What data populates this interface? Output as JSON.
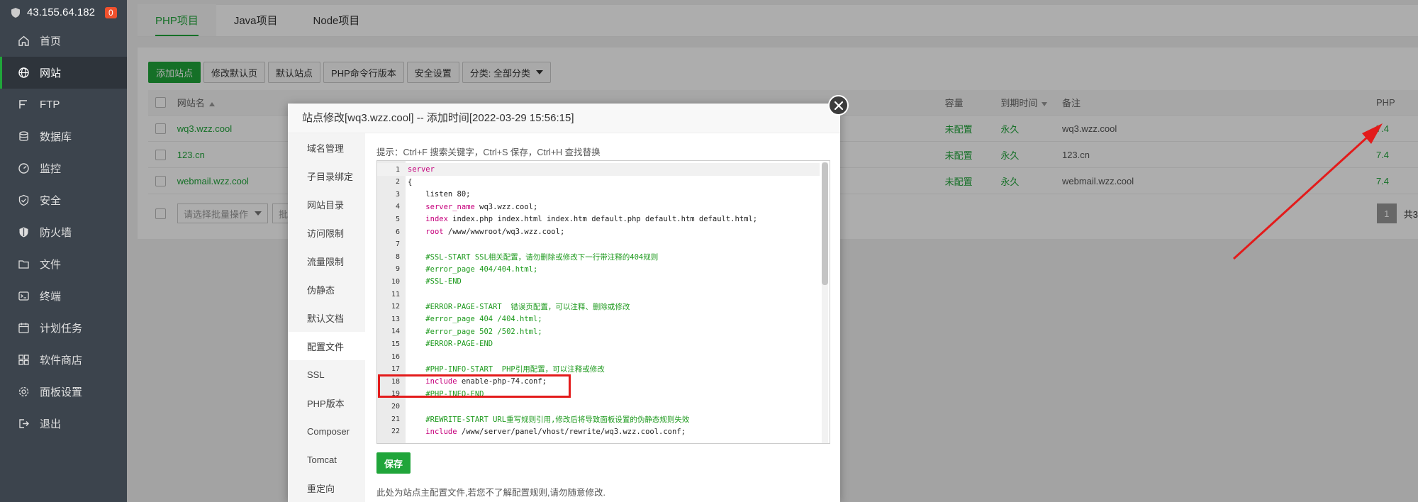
{
  "sidebar": {
    "server_ip": "43.155.64.182",
    "badge": "0",
    "items": [
      {
        "label": "首页",
        "icon": "home-icon"
      },
      {
        "label": "网站",
        "icon": "globe-icon",
        "active": true
      },
      {
        "label": "FTP",
        "icon": "ftp-icon"
      },
      {
        "label": "数据库",
        "icon": "database-icon"
      },
      {
        "label": "监控",
        "icon": "monitor-icon"
      },
      {
        "label": "安全",
        "icon": "shield-check-icon"
      },
      {
        "label": "防火墙",
        "icon": "firewall-icon"
      },
      {
        "label": "文件",
        "icon": "folder-icon"
      },
      {
        "label": "终端",
        "icon": "terminal-icon"
      },
      {
        "label": "计划任务",
        "icon": "calendar-icon"
      },
      {
        "label": "软件商店",
        "icon": "apps-icon"
      },
      {
        "label": "面板设置",
        "icon": "gear-icon"
      },
      {
        "label": "退出",
        "icon": "logout-icon"
      }
    ]
  },
  "tabs": [
    {
      "label": "PHP项目",
      "active": true
    },
    {
      "label": "Java项目"
    },
    {
      "label": "Node项目"
    }
  ],
  "toolbar": {
    "add_site": "添加站点",
    "edit_default_page": "修改默认页",
    "default_site": "默认站点",
    "php_cli_version": "PHP命令行版本",
    "security_settings": "安全设置",
    "category_filter": "分类: 全部分类"
  },
  "table": {
    "headers": {
      "name": "网站名",
      "capacity": "容量",
      "expire": "到期时间",
      "note": "备注",
      "php": "PHP"
    },
    "rows": [
      {
        "name": "wq3.wzz.cool",
        "capacity": "未配置",
        "expire": "永久",
        "note": "wq3.wzz.cool",
        "php": "7.4"
      },
      {
        "name": "123.cn",
        "capacity": "未配置",
        "expire": "永久",
        "note": "123.cn",
        "php": "7.4"
      },
      {
        "name": "webmail.wzz.cool",
        "capacity": "未配置",
        "expire": "永久",
        "note": "webmail.wzz.cool",
        "php": "7.4"
      }
    ],
    "batch_placeholder": "请选择批量操作",
    "batch_placeholder_2": "批",
    "page": "1",
    "total_prefix": "共3"
  },
  "modal": {
    "title": "站点修改[wq3.wzz.cool] -- 添加时间[2022-03-29 15:56:15]",
    "nav": [
      "域名管理",
      "子目录绑定",
      "网站目录",
      "访问限制",
      "流量限制",
      "伪静态",
      "默认文档",
      "配置文件",
      "SSL",
      "PHP版本",
      "Composer",
      "Tomcat",
      "重定向"
    ],
    "active_nav": "配置文件",
    "hint": "提示：Ctrl+F 搜索关键字，Ctrl+S 保存，Ctrl+H 查找替换",
    "save_label": "保存",
    "note": "此处为站点主配置文件,若您不了解配置规则,请勿随意修改."
  },
  "code_lines": [
    {
      "n": "1",
      "parts": [
        [
          "kw",
          "server"
        ]
      ]
    },
    {
      "n": "2",
      "parts": [
        [
          "",
          "{"
        ]
      ]
    },
    {
      "n": "3",
      "parts": [
        [
          "",
          "    listen 80;"
        ]
      ]
    },
    {
      "n": "4",
      "parts": [
        [
          "",
          "    "
        ],
        [
          "kw",
          "server_name"
        ],
        [
          "",
          " wq3.wzz.cool;"
        ]
      ]
    },
    {
      "n": "5",
      "parts": [
        [
          "",
          "    "
        ],
        [
          "kw",
          "index"
        ],
        [
          "",
          " index.php index.html index.htm default.php default.htm default.html;"
        ]
      ]
    },
    {
      "n": "6",
      "parts": [
        [
          "",
          "    "
        ],
        [
          "kw",
          "root"
        ],
        [
          "",
          " /www/wwwroot/wq3.wzz.cool;"
        ]
      ]
    },
    {
      "n": "7",
      "parts": [
        [
          "",
          ""
        ]
      ]
    },
    {
      "n": "8",
      "parts": [
        [
          "cm",
          "    #SSL-START SSL相关配置，请勿删除或修改下一行带注释的404规则"
        ]
      ]
    },
    {
      "n": "9",
      "parts": [
        [
          "cm",
          "    #error_page 404/404.html;"
        ]
      ]
    },
    {
      "n": "10",
      "parts": [
        [
          "cm",
          "    #SSL-END"
        ]
      ]
    },
    {
      "n": "11",
      "parts": [
        [
          "",
          ""
        ]
      ]
    },
    {
      "n": "12",
      "parts": [
        [
          "cm",
          "    #ERROR-PAGE-START  错误页配置，可以注释、删除或修改"
        ]
      ]
    },
    {
      "n": "13",
      "parts": [
        [
          "cm",
          "    #error_page 404 /404.html;"
        ]
      ]
    },
    {
      "n": "14",
      "parts": [
        [
          "cm",
          "    #error_page 502 /502.html;"
        ]
      ]
    },
    {
      "n": "15",
      "parts": [
        [
          "cm",
          "    #ERROR-PAGE-END"
        ]
      ]
    },
    {
      "n": "16",
      "parts": [
        [
          "",
          ""
        ]
      ]
    },
    {
      "n": "17",
      "parts": [
        [
          "cm",
          "    #PHP-INFO-START  PHP引用配置，可以注释或修改"
        ]
      ]
    },
    {
      "n": "18",
      "parts": [
        [
          "",
          "    "
        ],
        [
          "kw",
          "include"
        ],
        [
          "",
          " enable-php-74.conf;"
        ]
      ]
    },
    {
      "n": "19",
      "parts": [
        [
          "cm",
          "    #PHP-INFO-END"
        ]
      ]
    },
    {
      "n": "20",
      "parts": [
        [
          "",
          ""
        ]
      ]
    },
    {
      "n": "21",
      "parts": [
        [
          "cm",
          "    #REWRITE-START URL重写规则引用,修改后将导致面板设置的伪静态规则失效"
        ]
      ]
    },
    {
      "n": "22",
      "parts": [
        [
          "",
          "    "
        ],
        [
          "kw",
          "include"
        ],
        [
          "",
          " /www/server/panel/vhost/rewrite/wq3.wzz.cool.conf;"
        ]
      ]
    }
  ],
  "colors": {
    "accent": "#20a53a",
    "sidebar_bg": "#3c444d",
    "annotation_red": "#e31b1b"
  }
}
